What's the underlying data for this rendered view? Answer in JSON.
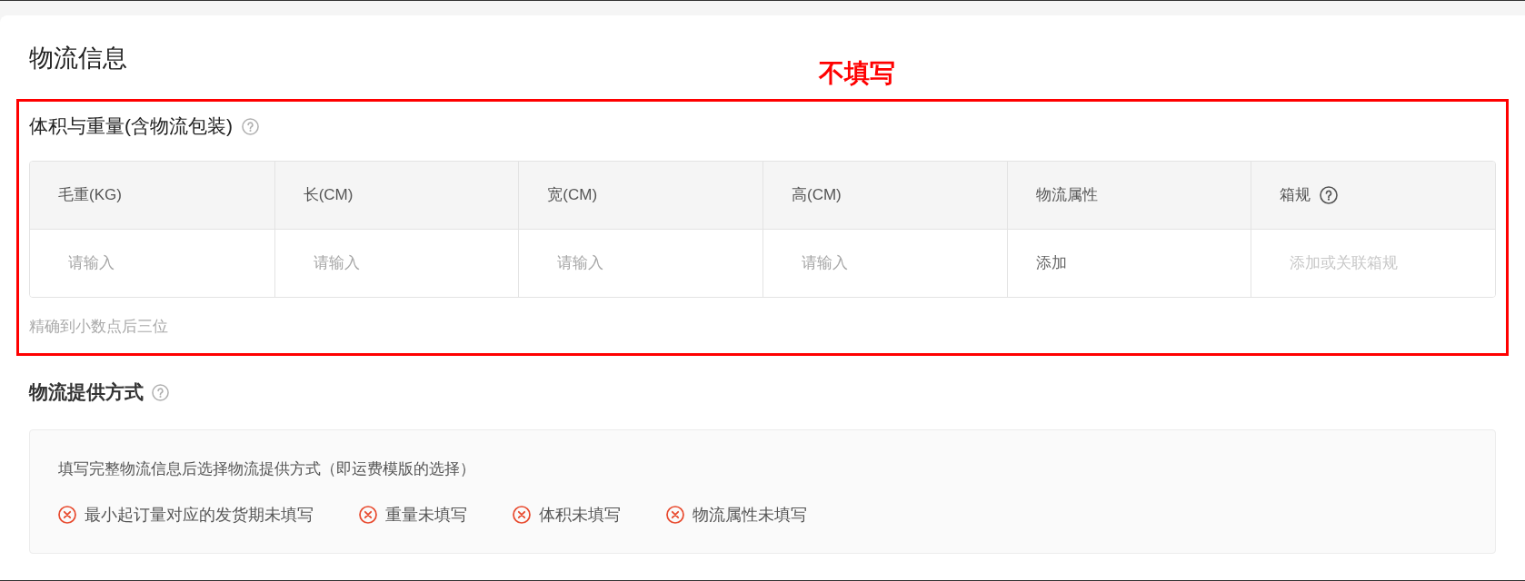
{
  "page": {
    "title": "物流信息",
    "annotation": "不填写"
  },
  "dimensions": {
    "title": "体积与重量(含物流包装)",
    "columns": [
      {
        "label": "毛重(KG)",
        "help": false
      },
      {
        "label": "长(CM)",
        "help": false
      },
      {
        "label": "宽(CM)",
        "help": false
      },
      {
        "label": "高(CM)",
        "help": false
      },
      {
        "label": "物流属性",
        "help": false
      },
      {
        "label": "箱规",
        "help": true
      }
    ],
    "cells": [
      {
        "kind": "input",
        "placeholder": "请输入",
        "disabled": false
      },
      {
        "kind": "input",
        "placeholder": "请输入",
        "disabled": false
      },
      {
        "kind": "input",
        "placeholder": "请输入",
        "disabled": false
      },
      {
        "kind": "input",
        "placeholder": "请输入",
        "disabled": false
      },
      {
        "kind": "link",
        "text": "添加"
      },
      {
        "kind": "input",
        "placeholder": "添加或关联箱规",
        "disabled": true
      }
    ],
    "hint": "精确到小数点后三位"
  },
  "shipping": {
    "title": "物流提供方式",
    "description": "填写完整物流信息后选择物流提供方式（即运费模版的选择）",
    "errors": [
      "最小起订量对应的发货期未填写",
      "重量未填写",
      "体积未填写",
      "物流属性未填写"
    ]
  }
}
